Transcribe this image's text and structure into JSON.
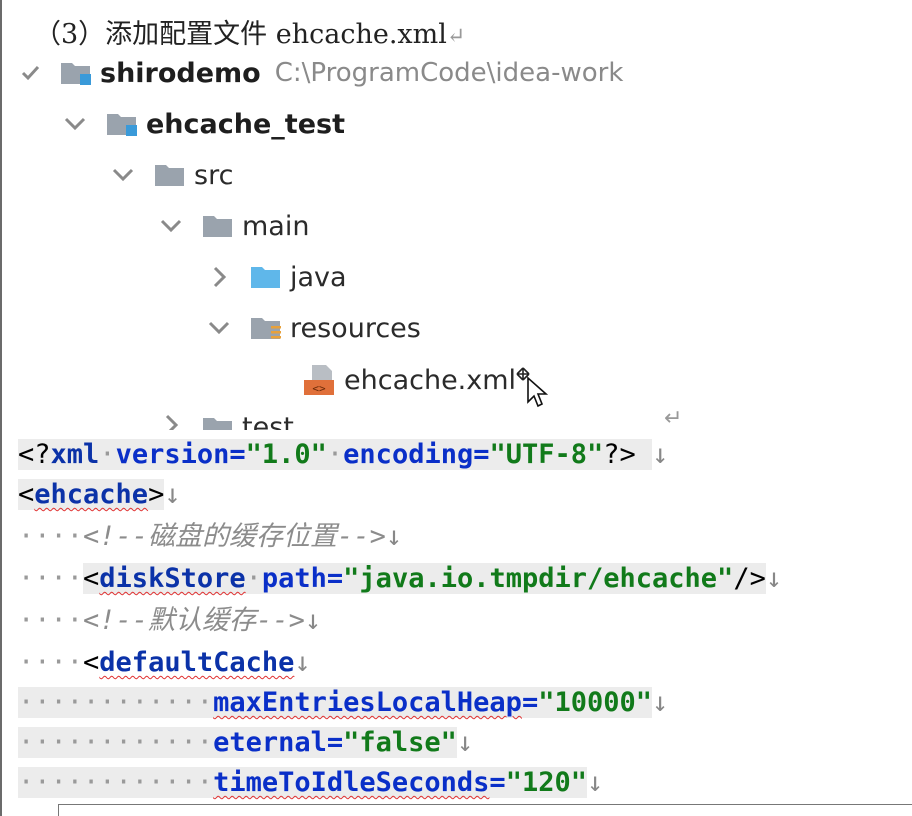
{
  "heading": {
    "text": "（3）添加配置文件 ehcache.xml",
    "mark": "↵"
  },
  "tree": {
    "root": {
      "label": "shirodemo",
      "path": "C:\\ProgramCode\\idea-work"
    },
    "module": {
      "label": "ehcache_test"
    },
    "src": {
      "label": "src"
    },
    "main": {
      "label": "main"
    },
    "java": {
      "label": "java"
    },
    "resources": {
      "label": "resources"
    },
    "file": {
      "label": "ehcache.xml"
    },
    "test": {
      "label": "test"
    },
    "return_mark": "↵"
  },
  "code": {
    "line1": {
      "open": "<?",
      "tagname": "xml",
      "attr1": "version",
      "eq1": "=",
      "val1": "\"1.0\"",
      "attr2": "encoding",
      "eq2": "=",
      "val2": "\"UTF-8\"",
      "close": "?>",
      "nl": "↓"
    },
    "line2": {
      "open": "<",
      "tagname": "ehcache",
      "close": ">",
      "nl": "↓"
    },
    "line3": {
      "indent": "····",
      "comment": "<!--磁盘的缓存位置-->",
      "nl": "↓"
    },
    "line4": {
      "indent": "····",
      "open": "<",
      "tagname": "diskStore",
      "attr": "path",
      "eq": "=",
      "val": "\"java.io.tmpdir/ehcache\"",
      "close": "/>",
      "nl": "↓"
    },
    "line5": {
      "indent": "····",
      "comment": "<!--默认缓存-->",
      "nl": "↓"
    },
    "line6": {
      "indent": "····",
      "open": "<",
      "tagname": "defaultCache",
      "nl": "↓"
    },
    "line7": {
      "indent": "············",
      "attr": "maxEntriesLocalHeap",
      "eq": "=",
      "val": "\"10000\"",
      "nl": "↓"
    },
    "line8": {
      "indent": "············",
      "attr": "eternal",
      "eq": "=",
      "val": "\"false\"",
      "nl": "↓"
    },
    "line9": {
      "indent": "············",
      "attr": "timeToIdleSeconds",
      "eq": "=",
      "val": "\"120\"",
      "nl": "↓"
    }
  },
  "colors": {
    "folder": "#9aa3ad",
    "source_folder": "#5fb7ea",
    "module_badge": "#3a9ad9",
    "xml_file": "#e0703a",
    "tag": "#0b32a8",
    "attribute": "#0a2fc8",
    "value": "#117a1a",
    "comment": "#8c8c8c"
  }
}
